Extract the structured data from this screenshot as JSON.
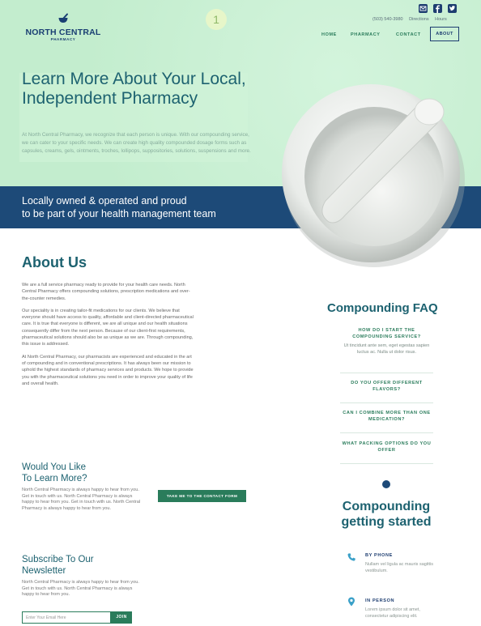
{
  "header": {
    "logo_title": "NORTH CENTRAL",
    "logo_subtitle": "PHARMACY",
    "page_badge": "1",
    "phone": "(503) 540-3980",
    "directions": "Directions",
    "hours": "Hours",
    "social_icons": [
      "email-icon",
      "facebook-icon",
      "twitter-icon"
    ],
    "nav": [
      "HOME",
      "PHARMACY",
      "CONTACT",
      "ABOUT"
    ]
  },
  "hero": {
    "title": "Learn More About Your Local, Independent Pharmacy",
    "text": "At North Central Pharmacy, we recognize that each person is unique. With our compounding service, we can cater to your specific needs. We can create high quality compounded dosage forms such as capsules, creams, gels, ointments, troches, lollipops, suppositories, solutions, suspensions and more."
  },
  "band": {
    "line1": "Locally owned & operated and proud",
    "line2": "to be part of your health management team"
  },
  "about": {
    "title": "About Us",
    "paragraphs": [
      "We are a full service pharmacy ready to provide for your health care needs. North Central Pharmacy offers compounding solutions, prescription medications and over-the-counter remedies.",
      "Our speciality is in creating tailor-fit medications for our clients. We believe that everyone should have access to quality, affordable and client-directed pharmaceutical care. It is true that everyone is different, we are all unique and our health situations consequently differ from the next person. Because of our client-first requirements, pharmaceutical solutions should also be as unique as we are. Through compounding, this issue is addressed.",
      "At North Central Pharmacy, our pharmacists are experienced and educated in the art of compounding and in conventional prescriptions. It has always been our mission to uphold the highest standards of pharmacy services and products. We hope to provide you with the pharmaceutical solutions you need in order to improve your quality of life and overall health."
    ]
  },
  "faq": {
    "title": "Compounding FAQ",
    "items": [
      {
        "q": "HOW DO I START THE COMPOUNDING SERVICE?",
        "a": "Ut tincidunt ante sem, eget egestas sapien luctus ac. Nulla ut dolor risus."
      },
      {
        "q": "DO YOU OFFER DIFFERENT FLAVORS?",
        "a": ""
      },
      {
        "q": "CAN I COMBINE MORE THAN ONE MEDICATION?",
        "a": ""
      },
      {
        "q": "WHAT PACKING OPTIONS DO YOU OFFER",
        "a": ""
      }
    ]
  },
  "getting_started": {
    "title": "Compounding getting started",
    "items": [
      {
        "label": "BY PHONE",
        "text": "Nullam vel ligula ac mauris sagittis vestibulum.",
        "icon": "phone-icon"
      },
      {
        "label": "IN PERSON",
        "text": "Lorem ipsum dolor sit amet, consectetur adipiscing elit.",
        "icon": "location-pin-icon"
      }
    ]
  },
  "learn_more": {
    "title_line1": "Would You Like",
    "title_line2": "To Learn More?",
    "text": "North Central Pharmacy is always happy to hear from you. Get in touch with us. North Central Pharmacy is always happy to hear from you. Get in touch with us. North Central Pharmacy is always happy to hear from you.",
    "button": "TAKE ME TO THE CONTACT FORM"
  },
  "newsletter": {
    "title_line1": "Subscribe To Our",
    "title_line2": "Newsletter",
    "text": "North Central Pharmacy is always happy to hear from you. Get in touch with us. North Central Pharmacy is always happy to hear from you.",
    "placeholder": "Enter Your Email Here",
    "button": "JOIN"
  },
  "colors": {
    "hero_bg": "#c3edce",
    "navy": "#1d4a78",
    "teal_text": "#1d6270",
    "green_accent": "#2a7c5b"
  }
}
